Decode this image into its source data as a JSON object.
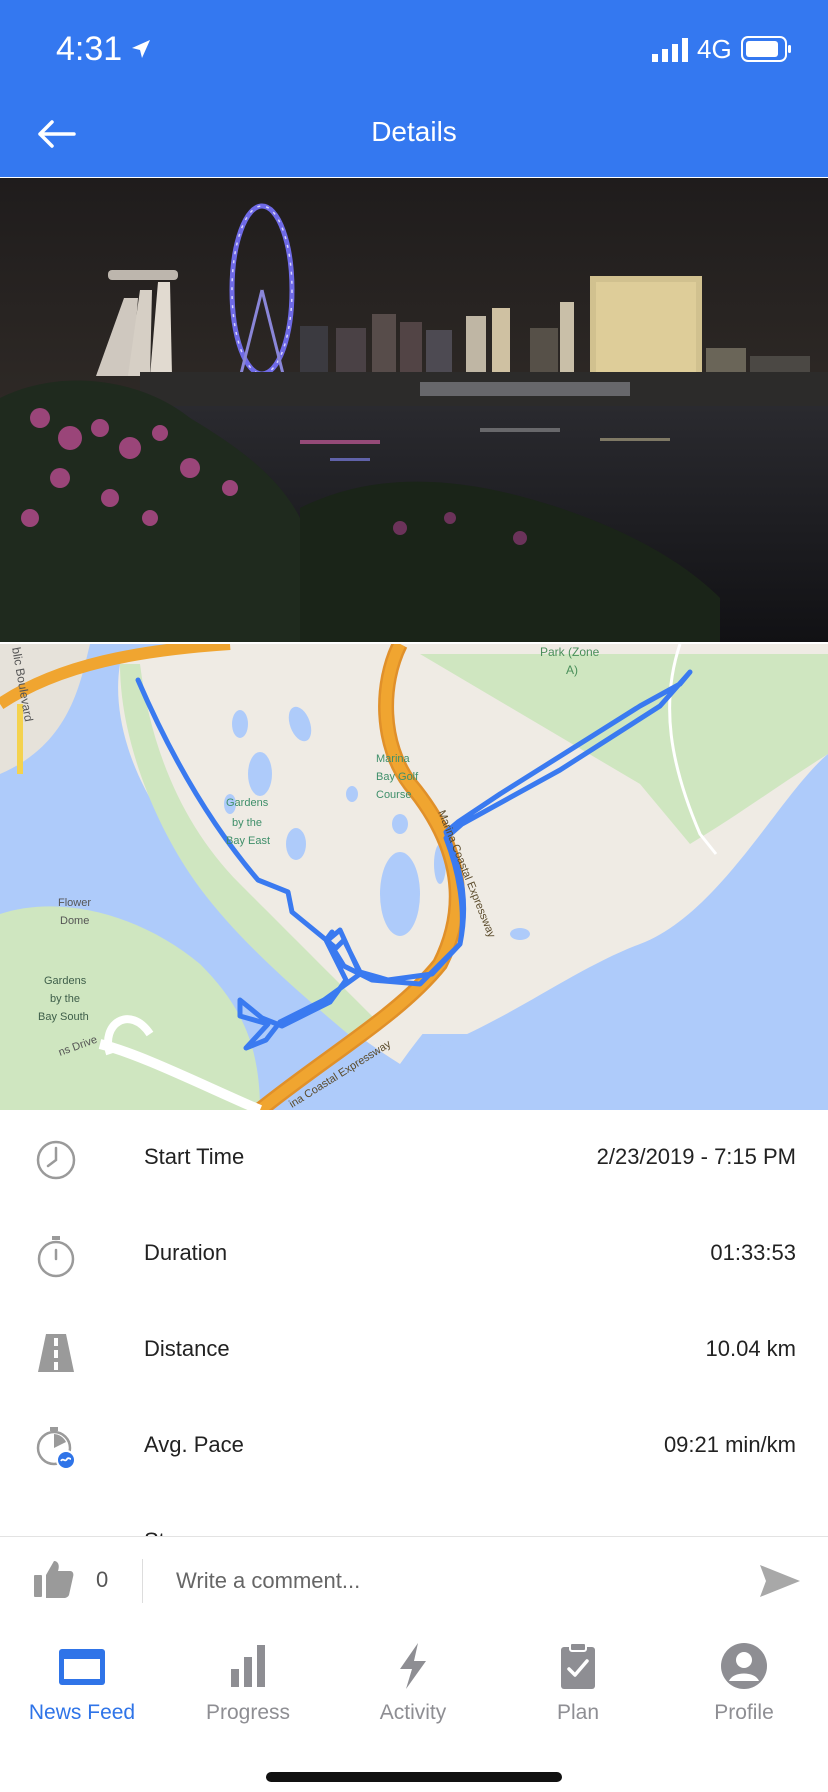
{
  "status_bar": {
    "time": "4:31",
    "network": "4G"
  },
  "header": {
    "title": "Details"
  },
  "map_labels": {
    "public_boulevard": "blic Boulevard",
    "park_zone_1": "Park (Zone",
    "park_zone_2": "A)",
    "golf_1": "Marina",
    "golf_2": "Bay Golf",
    "golf_3": "Course",
    "gardens_east_1": "Gardens",
    "gardens_east_2": "by the",
    "gardens_east_3": "Bay East",
    "flower_dome_1": "Flower",
    "flower_dome_2": "Dome",
    "gardens_south_1": "Gardens",
    "gardens_south_2": "by the",
    "gardens_south_3": "Bay South",
    "drive": "ns Drive",
    "expressway_1": "Marina Coastal Expressway",
    "expressway_2": "ina Coastal Expressway"
  },
  "stats": [
    {
      "icon": "clock-icon",
      "label": "Start Time",
      "value": "2/23/2019 - 7:15 PM"
    },
    {
      "icon": "stopwatch-icon",
      "label": "Duration",
      "value": "01:33:53"
    },
    {
      "icon": "road-icon",
      "label": "Distance",
      "value": "10.04 km"
    },
    {
      "icon": "pace-icon",
      "label": "Avg. Pace",
      "value": "09:21 min/km"
    }
  ],
  "stats_cut_label": "Steps",
  "comment_bar": {
    "like_count": "0",
    "placeholder": "Write a comment..."
  },
  "tabs": [
    {
      "label": "News Feed",
      "icon": "news-feed-icon",
      "active": true
    },
    {
      "label": "Progress",
      "icon": "bar-chart-icon"
    },
    {
      "label": "Activity",
      "icon": "lightning-icon"
    },
    {
      "label": "Plan",
      "icon": "clipboard-icon"
    },
    {
      "label": "Profile",
      "icon": "profile-icon"
    }
  ],
  "colors": {
    "accent": "#3478f0",
    "route": "#3a7af0",
    "water": "#aecbfa",
    "park": "#cfe6c0",
    "road": "#f0a530",
    "tab_inactive": "#8e8e93"
  }
}
